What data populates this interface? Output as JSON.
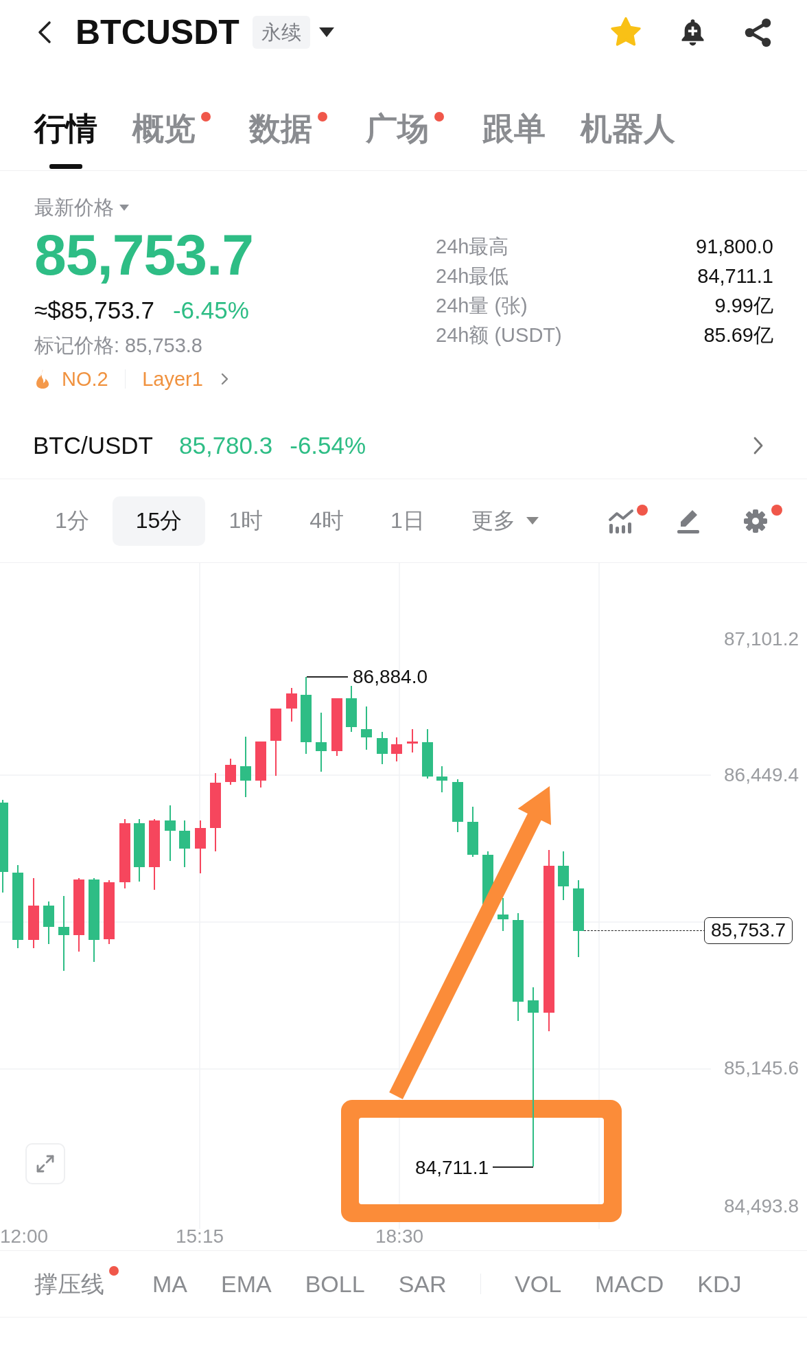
{
  "header": {
    "title": "BTCUSDT",
    "contract_type": "永续"
  },
  "tabs": [
    {
      "label": "行情",
      "selected": true,
      "dot": false
    },
    {
      "label": "概览",
      "selected": false,
      "dot": true
    },
    {
      "label": "数据",
      "selected": false,
      "dot": true
    },
    {
      "label": "广场",
      "selected": false,
      "dot": true
    },
    {
      "label": "跟单",
      "selected": false,
      "dot": false
    },
    {
      "label": "机器人",
      "selected": false,
      "dot": false
    }
  ],
  "price": {
    "type_label": "最新价格",
    "last": "85,753.7",
    "usd": "≈$85,753.7",
    "change": "-6.45%",
    "mark_price": "标记价格: 85,753.8",
    "rank": "NO.2",
    "sector": "Layer1"
  },
  "stats": [
    {
      "label": "24h最高",
      "value": "91,800.0"
    },
    {
      "label": "24h最低",
      "value": "84,711.1"
    },
    {
      "label": "24h量 (张)",
      "value": "9.99亿"
    },
    {
      "label": "24h额 (USDT)",
      "value": "85.69亿"
    }
  ],
  "spot": {
    "pair": "BTC/USDT",
    "price": "85,780.3",
    "change": "-6.54%"
  },
  "intervals": [
    {
      "label": "1分",
      "selected": false,
      "kind": "interval"
    },
    {
      "label": "15分",
      "selected": true,
      "kind": "interval"
    },
    {
      "label": "1时",
      "selected": false,
      "kind": "interval"
    },
    {
      "label": "4时",
      "selected": false,
      "kind": "interval"
    },
    {
      "label": "1日",
      "selected": false,
      "kind": "interval"
    },
    {
      "label": "更多",
      "selected": false,
      "kind": "menu"
    }
  ],
  "chart_tools": [
    {
      "kind": "indicators",
      "dot": true
    },
    {
      "kind": "draw",
      "dot": false
    },
    {
      "kind": "settings",
      "dot": true
    }
  ],
  "chart": {
    "price_axis": [
      "87,101.2",
      "86,449.4",
      "85,145.6",
      "84,493.8"
    ],
    "time_axis": [
      "12:00",
      "15:15",
      "18:30"
    ],
    "high": "86,884.0",
    "low": "84,711.1",
    "last_price": "85,753.7"
  },
  "indicators": {
    "main": [
      {
        "label": "撑压线",
        "dot": true
      },
      {
        "label": "MA",
        "dot": false
      },
      {
        "label": "EMA",
        "dot": false
      },
      {
        "label": "BOLL",
        "dot": false
      },
      {
        "label": "SAR",
        "dot": false
      }
    ],
    "sub": [
      {
        "label": "VOL"
      },
      {
        "label": "MACD"
      },
      {
        "label": "KDJ"
      }
    ]
  }
}
